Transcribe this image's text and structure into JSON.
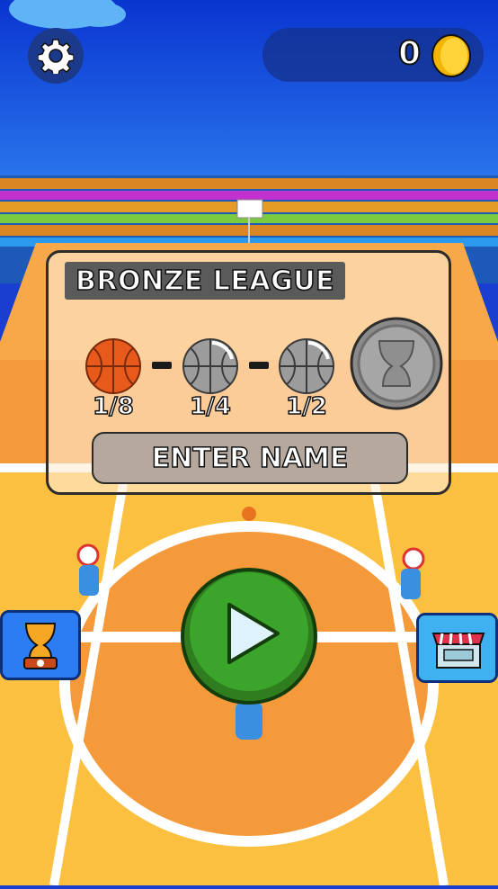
{
  "hud": {
    "settings_icon": "gear-icon",
    "coins": "0",
    "coin_icon": "gold-coin-icon"
  },
  "league": {
    "title": "BRONZE LEAGUE",
    "stages": [
      {
        "label": "1/8",
        "icon": "orange-basketball-icon",
        "state": "current"
      },
      {
        "label": "1/4",
        "icon": "gray-basketball-icon",
        "state": "locked"
      },
      {
        "label": "1/2",
        "icon": "gray-basketball-icon",
        "state": "locked"
      }
    ],
    "trophy_icon": "gray-trophy-icon",
    "enter_name_label": "ENTER NAME"
  },
  "buttons": {
    "play_icon": "play-icon",
    "trophies_icon": "trophy-icon",
    "shop_icon": "shop-icon"
  },
  "colors": {
    "sky": "#1a46d8",
    "court_orange": "#f59a3a",
    "court_yellow": "#fbc040",
    "play_green": "#3aa52a",
    "side_button_blue": "#2c7cf2"
  }
}
